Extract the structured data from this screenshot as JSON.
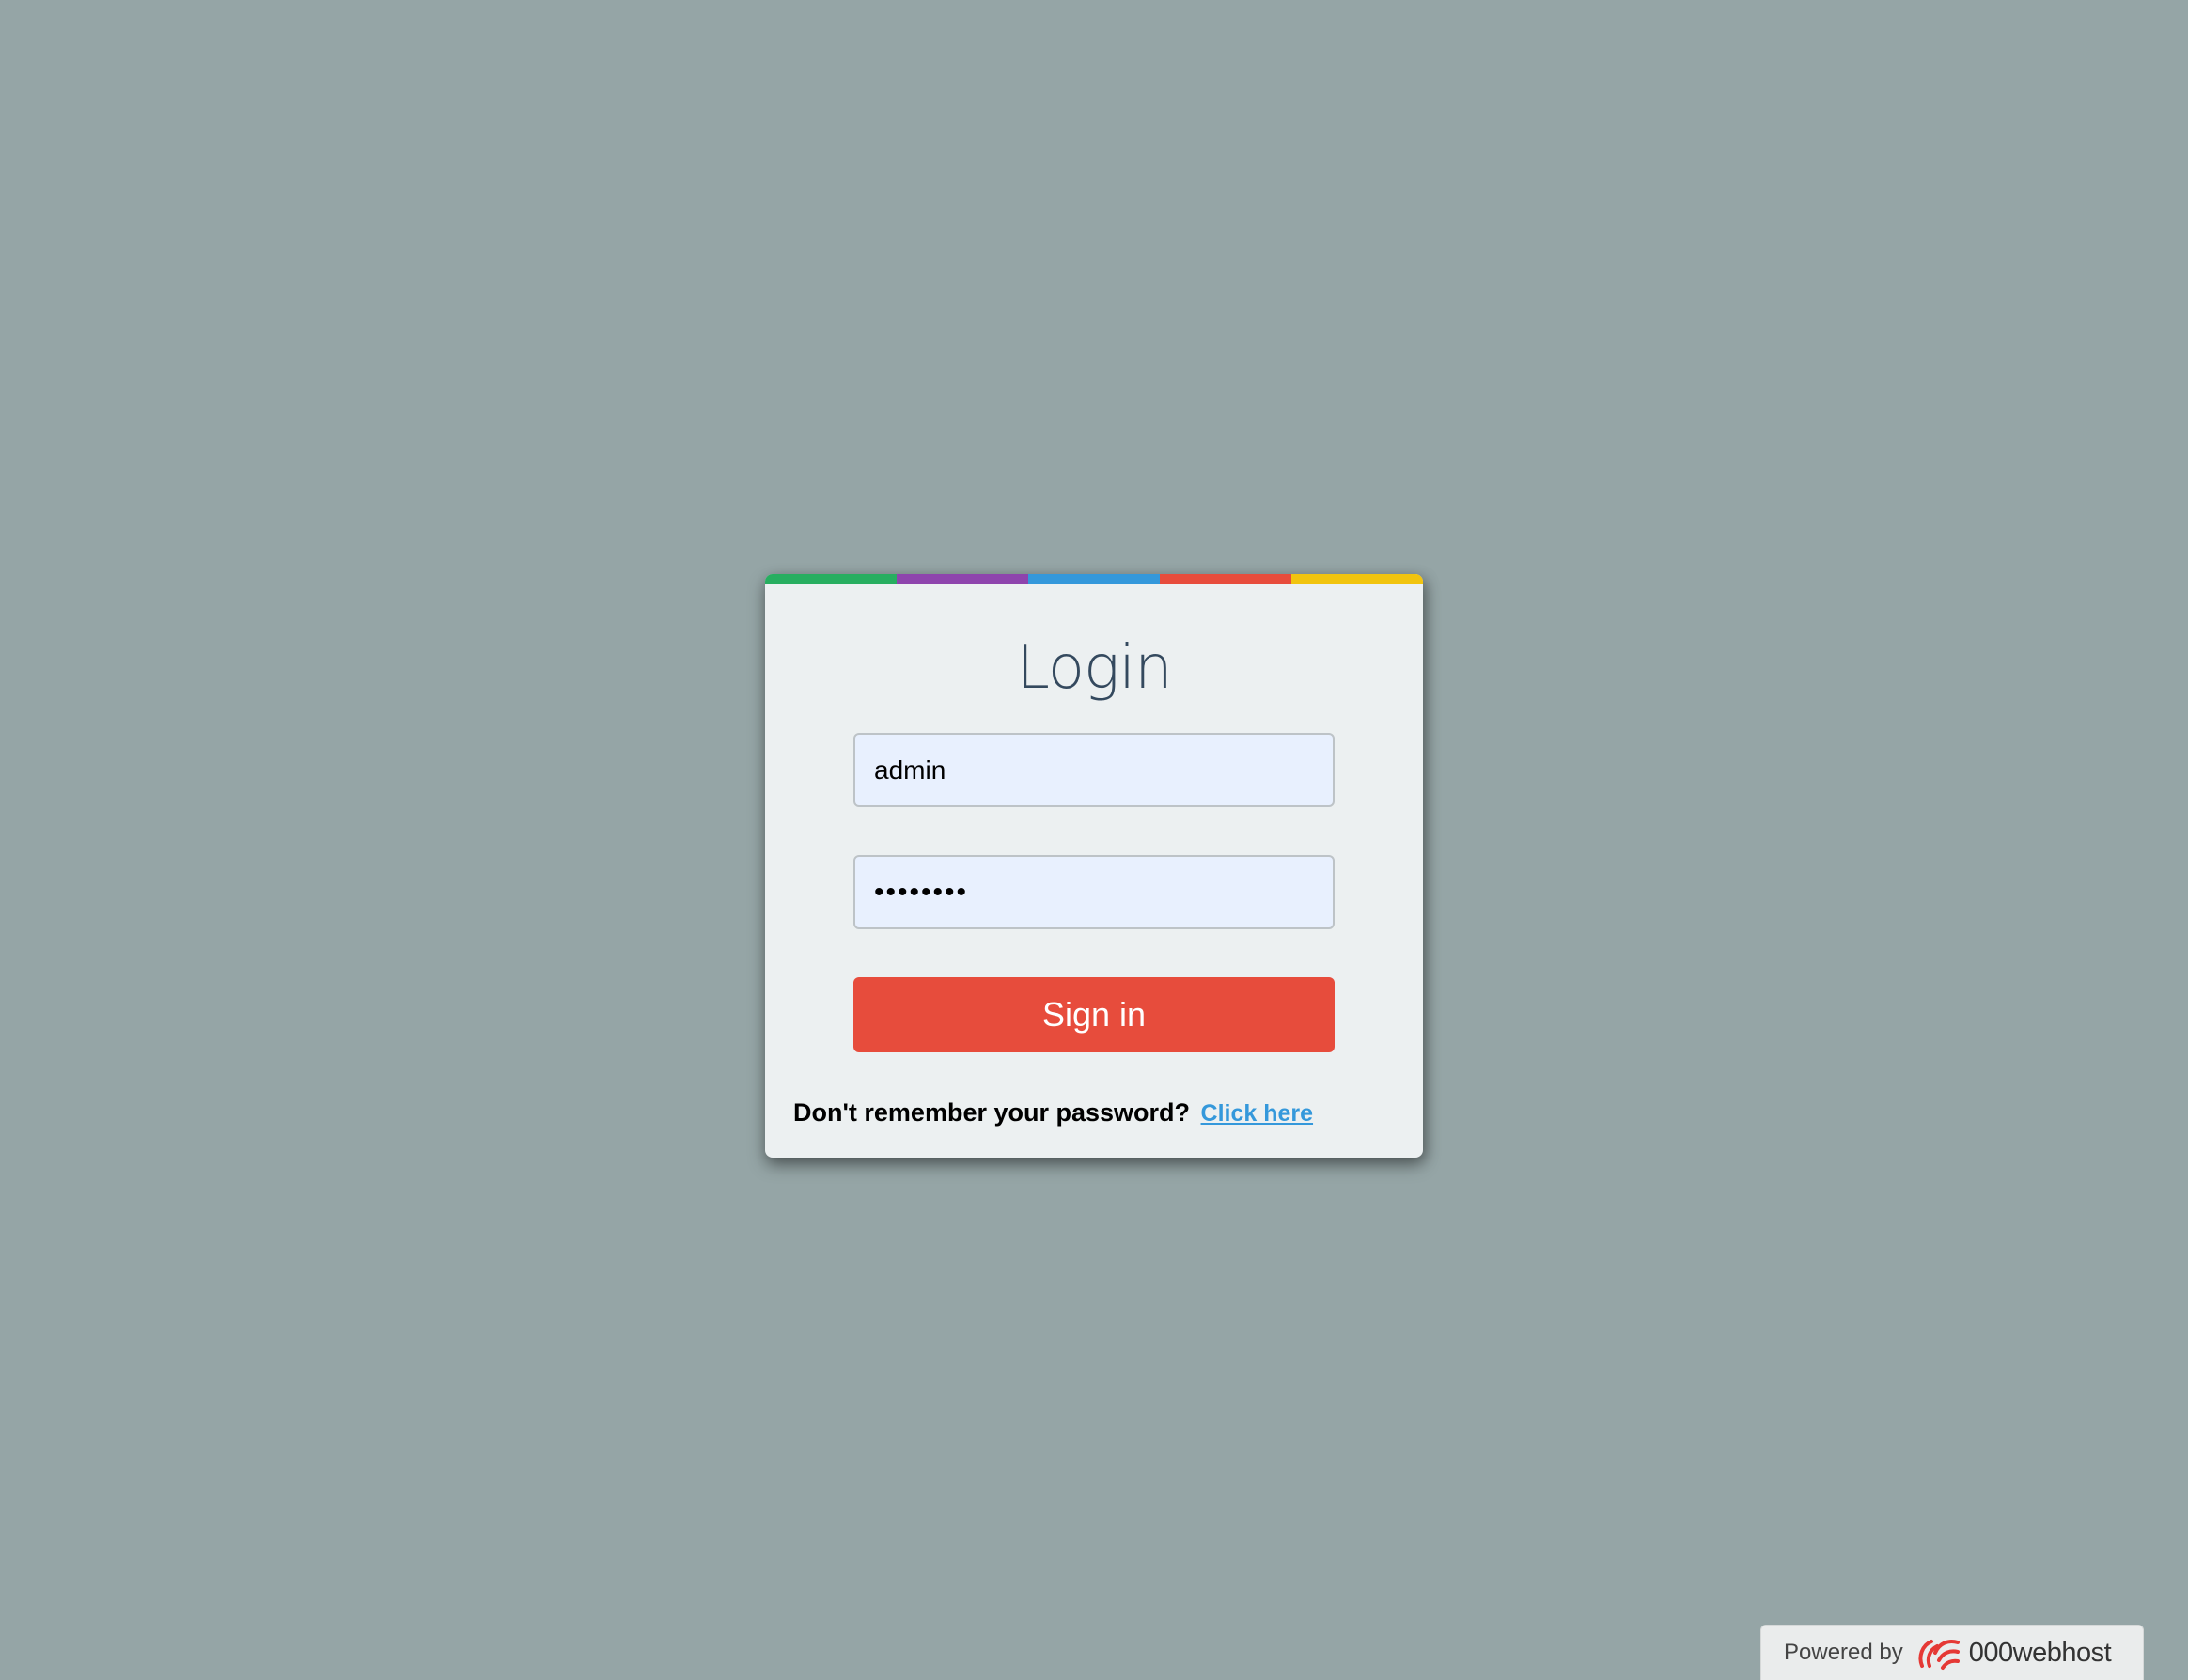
{
  "login": {
    "title": "Login",
    "username_value": "admin",
    "password_value": "••••••••",
    "signin_label": "Sign in",
    "forgot_text": "Don't remember your password?",
    "forgot_link": "Click here"
  },
  "colors": {
    "background": "#95a5a6",
    "card": "#ecf0f1",
    "accent_bar": [
      "#27ae60",
      "#8e44ad",
      "#3498db",
      "#e74c3c",
      "#f1c40f"
    ],
    "signin_button": "#e74c3c",
    "link": "#3498db",
    "title": "#34495e"
  },
  "footer": {
    "powered_by": "Powered by",
    "brand": "000webhost",
    "logo_icon": "000webhost-logo-icon"
  }
}
